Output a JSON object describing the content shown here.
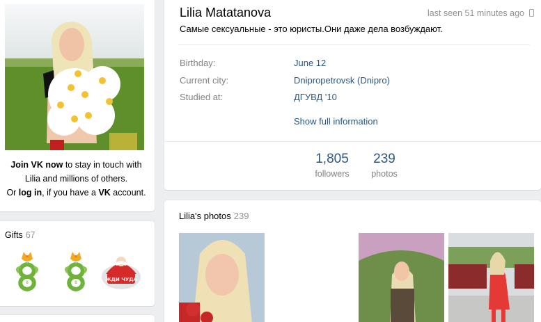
{
  "profile": {
    "name": "Lilia Matatanova",
    "last_seen": "last seen 51 minutes ago",
    "status": "Самые сексуальные - это юристы.Они даже дела возбуждают.",
    "info": [
      {
        "label": "Birthday:",
        "value": "June 12"
      },
      {
        "label": "Current city:",
        "value": "Dnipropetrovsk (Dnipro)"
      },
      {
        "label": "Studied at:",
        "value": "ДГУВД '10"
      }
    ],
    "show_full": "Show full information",
    "counters": [
      {
        "value": "1,805",
        "label": "followers"
      },
      {
        "value": "239",
        "label": "photos"
      }
    ]
  },
  "join": {
    "join_link": "Join VK now",
    "line1_rest": " to stay in touch with",
    "line2": "Lilia and millions of others.",
    "line3_pre": "Or ",
    "login_link": "log in",
    "line3_mid": ", if you have a ",
    "vk": "VK",
    "line3_post": " account."
  },
  "gifts": {
    "title": "Gifts",
    "count": "67",
    "labels": [
      "8",
      "8",
      "ЖДИ ЧУДА"
    ]
  },
  "photos": {
    "title": "Lilia's photos",
    "count": "239"
  },
  "icons": [
    "phone-icon"
  ],
  "colors": {
    "link": "#2a5885",
    "muted": "#828282",
    "background": "#edeef0"
  }
}
